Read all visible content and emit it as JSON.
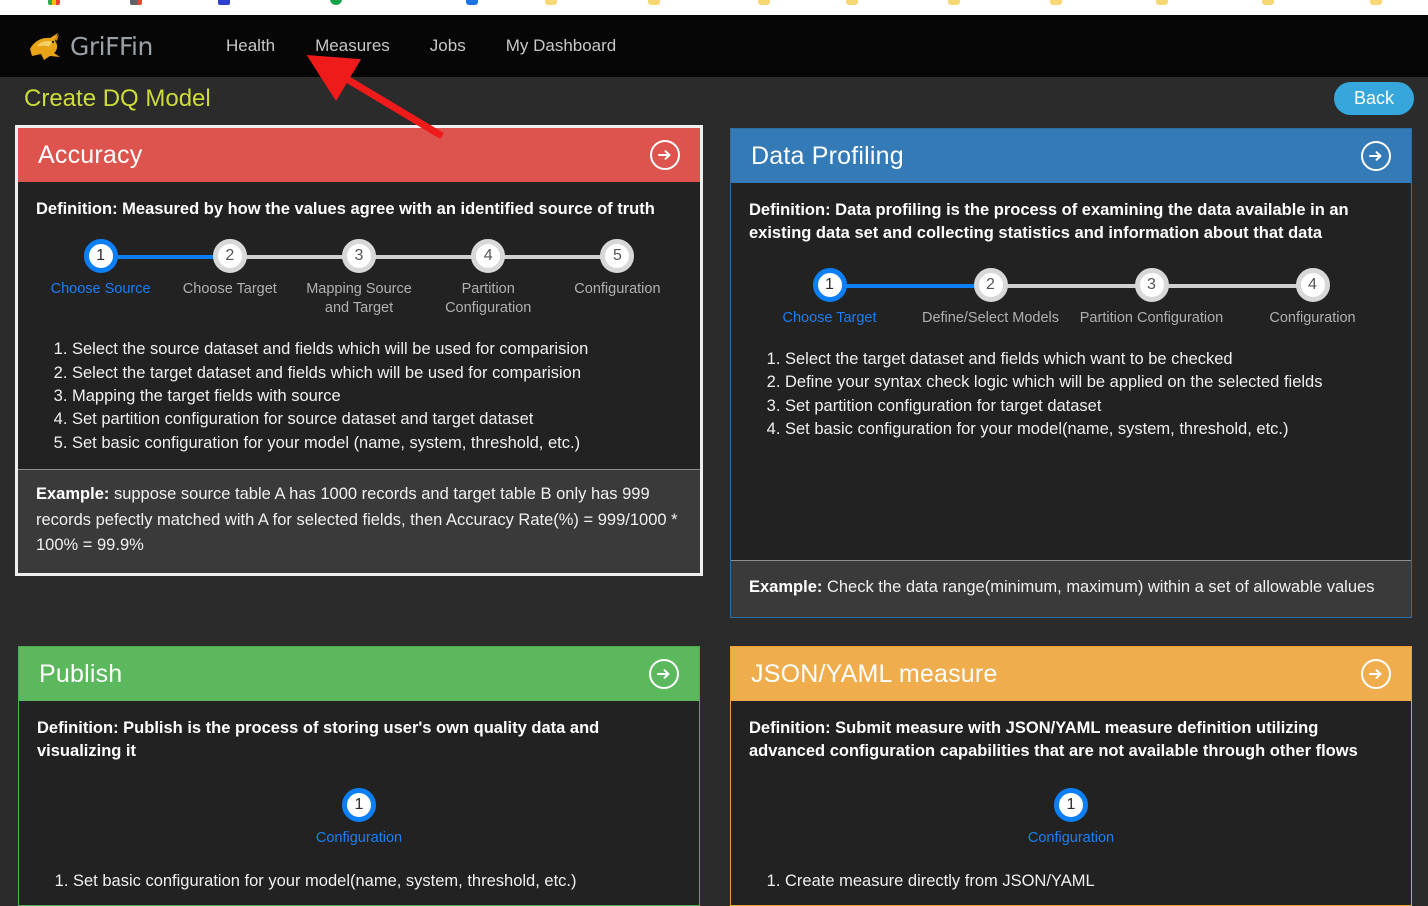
{
  "browser": {
    "bookmarks": [
      {
        "label": "",
        "icon": "colored-icon"
      },
      {
        "label": "",
        "icon": "colored-icon"
      },
      {
        "label": "",
        "icon": "blue-icon"
      },
      {
        "label": "",
        "icon": "green-icon"
      },
      {
        "label": "",
        "icon": "blue-icon"
      },
      {
        "label": "",
        "icon": "folder-icon"
      },
      {
        "label": "",
        "icon": "folder-icon"
      },
      {
        "label": "",
        "icon": "folder-icon"
      },
      {
        "label": "",
        "icon": "folder-icon"
      },
      {
        "label": "",
        "icon": "folder-icon"
      },
      {
        "label": "",
        "icon": "folder-icon"
      },
      {
        "label": "",
        "icon": "folder-icon"
      },
      {
        "label": "",
        "icon": "folder-icon"
      },
      {
        "label": "",
        "icon": "folder-icon"
      },
      {
        "label": "",
        "icon": "folder-icon"
      },
      {
        "label": "",
        "icon": "folder-icon"
      }
    ]
  },
  "navbar": {
    "brand": "GriFFin",
    "links": [
      {
        "label": "Health"
      },
      {
        "label": "Measures"
      },
      {
        "label": "Jobs"
      },
      {
        "label": "My Dashboard"
      }
    ]
  },
  "page": {
    "title": "Create DQ Model",
    "back_label": "Back"
  },
  "colors": {
    "accuracy": "#dd544e",
    "data_profiling": "#337ab7",
    "publish": "#5cb85c",
    "json_yaml": "#f0ad4e",
    "active_step": "#0d7ff5",
    "title": "#cddc39",
    "back_button": "#35a7dd",
    "page_background": "#2b2b2b",
    "card_background": "#222222"
  },
  "cards": {
    "accuracy": {
      "title": "Accuracy",
      "arrow_icon": "arrow-circle-right-icon",
      "definition": "Definition: Measured by how the values agree with an identified source of truth",
      "steps": [
        {
          "number": "1",
          "label": "Choose Source",
          "active": true
        },
        {
          "number": "2",
          "label": "Choose Target",
          "active": false
        },
        {
          "number": "3",
          "label": "Mapping Source and Target",
          "active": false
        },
        {
          "number": "4",
          "label": "Partition Configuration",
          "active": false
        },
        {
          "number": "5",
          "label": "Configuration",
          "active": false
        }
      ],
      "instructions": [
        "Select the source dataset and fields which will be used for comparision",
        "Select the target dataset and fields which will be used for comparision",
        "Mapping the target fields with source",
        "Set partition configuration for source dataset and target dataset",
        "Set basic configuration for your model (name, system, threshold, etc.)"
      ],
      "example_label": "Example:",
      "example_text": " suppose source table A has 1000 records and target table B only has 999 records pefectly matched with A for selected fields, then Accuracy Rate(%) = 999/1000 * 100% = 99.9%"
    },
    "data_profiling": {
      "title": "Data Profiling",
      "arrow_icon": "arrow-circle-right-icon",
      "definition": "Definition: Data profiling is the process of examining the data available in an existing data set and collecting statistics and information about that data",
      "steps": [
        {
          "number": "1",
          "label": "Choose Target",
          "active": true
        },
        {
          "number": "2",
          "label": "Define/Select Models",
          "active": false
        },
        {
          "number": "3",
          "label": "Partition Configuration",
          "active": false
        },
        {
          "number": "4",
          "label": "Configuration",
          "active": false
        }
      ],
      "instructions": [
        "Select the target dataset and fields which want to be checked",
        "Define your syntax check logic which will be applied on the selected fields",
        "Set partition configuration for target dataset",
        "Set basic configuration for your model(name, system, threshold, etc.)"
      ],
      "example_label": "Example:",
      "example_text": " Check the data range(minimum, maximum) within a set of allowable values"
    },
    "publish": {
      "title": "Publish",
      "arrow_icon": "arrow-circle-right-icon",
      "definition": "Definition: Publish is the process of storing user's own quality data and visualizing it",
      "steps": [
        {
          "number": "1",
          "label": "Configuration",
          "active": true
        }
      ],
      "instructions": [
        "Set basic configuration for your model(name, system, threshold, etc.)"
      ]
    },
    "json_yaml": {
      "title": "JSON/YAML measure",
      "arrow_icon": "arrow-circle-right-icon",
      "definition": "Definition: Submit measure with JSON/YAML measure definition utilizing advanced configuration capabilities that are not available through other flows",
      "steps": [
        {
          "number": "1",
          "label": "Configuration",
          "active": true
        }
      ],
      "instructions": [
        "Create measure directly from JSON/YAML"
      ]
    }
  },
  "annotation": {
    "type": "red-arrow",
    "points_at": "Measures"
  }
}
